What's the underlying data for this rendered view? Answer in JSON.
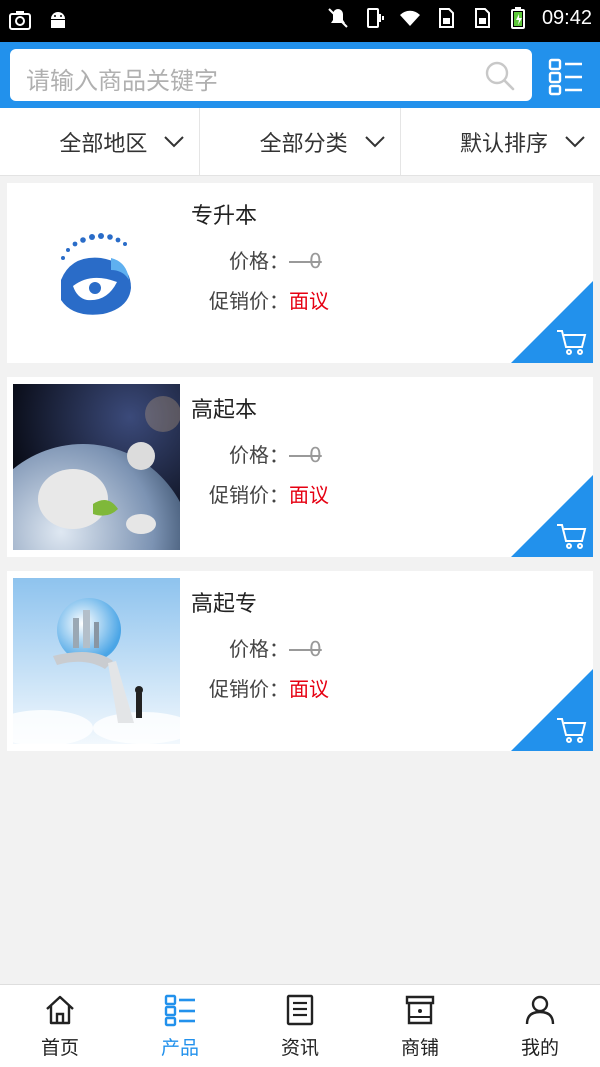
{
  "status_bar": {
    "time": "09:42",
    "icons": [
      "screenshot-icon",
      "android-icon",
      "mute-icon",
      "vibrate-icon",
      "wifi-icon",
      "sim1-icon",
      "sim2-icon",
      "battery-charging-icon"
    ]
  },
  "search": {
    "placeholder": "请输入商品关键字"
  },
  "filters": [
    {
      "label": "全部地区"
    },
    {
      "label": "全部分类"
    },
    {
      "label": "默认排序"
    }
  ],
  "products": [
    {
      "title": "专升本",
      "price_label": "价格：",
      "price_value": "0",
      "promo_label": "促销价：",
      "promo_value": "面议"
    },
    {
      "title": "高起本",
      "price_label": "价格：",
      "price_value": "0",
      "promo_label": "促销价：",
      "promo_value": "面议"
    },
    {
      "title": "高起专",
      "price_label": "价格：",
      "price_value": "0",
      "promo_label": "促销价：",
      "promo_value": "面议"
    }
  ],
  "bottom_nav": [
    {
      "label": "首页",
      "icon": "home-icon",
      "active": false
    },
    {
      "label": "产品",
      "icon": "product-list-icon",
      "active": true
    },
    {
      "label": "资讯",
      "icon": "news-icon",
      "active": false
    },
    {
      "label": "商铺",
      "icon": "shop-icon",
      "active": false
    },
    {
      "label": "我的",
      "icon": "user-icon",
      "active": false
    }
  ],
  "colors": {
    "accent": "#2291ec",
    "promo": "#e60012"
  }
}
